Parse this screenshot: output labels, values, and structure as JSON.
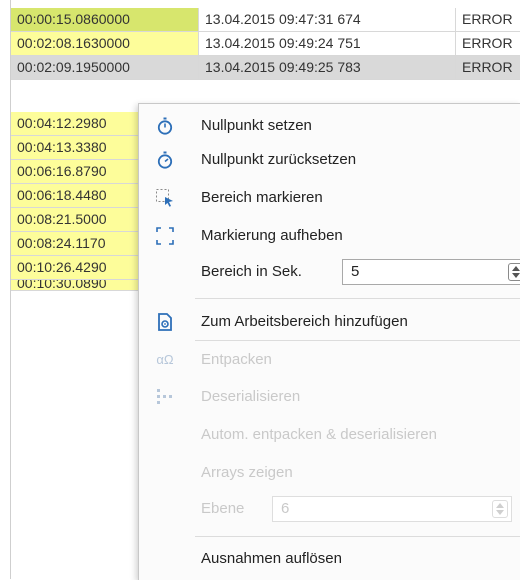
{
  "table": {
    "rows": [
      {
        "time": "00:00:15.0860000",
        "timestamp": "13.04.2015 09:47:31 674",
        "level": "ERROR"
      },
      {
        "time": "00:02:08.1630000",
        "timestamp": "13.04.2015 09:49:24 751",
        "level": "ERROR"
      },
      {
        "time": "00:02:09.1950000",
        "timestamp": "13.04.2015 09:49:25 783",
        "level": "ERROR"
      },
      {
        "time": "00:04:12.2980",
        "timestamp": "",
        "level": ""
      },
      {
        "time": "00:04:13.3380",
        "timestamp": "",
        "level": ""
      },
      {
        "time": "00:06:16.8790",
        "timestamp": "",
        "level": ""
      },
      {
        "time": "00:06:18.4480",
        "timestamp": "",
        "level": ""
      },
      {
        "time": "00:08:21.5000",
        "timestamp": "",
        "level": ""
      },
      {
        "time": "00:08:24.1170",
        "timestamp": "",
        "level": ""
      },
      {
        "time": "00:10:26.4290",
        "timestamp": "",
        "level": ""
      },
      {
        "time": "00:10:30.0890",
        "timestamp": "",
        "level": ""
      }
    ]
  },
  "menu": {
    "set_zero": "Nullpunkt setzen",
    "reset_zero": "Nullpunkt zurücksetzen",
    "mark_range": "Bereich markieren",
    "unmark": "Markierung aufheben",
    "range_label": "Bereich in Sek.",
    "range_value": "5",
    "add_workspace": "Zum Arbeitsbereich hinzufügen",
    "unpack_icon_text": "αΩ",
    "unpack": "Entpacken",
    "deserialize": "Deserialisieren",
    "auto_unpack": "Autom. entpacken & deserialisieren",
    "show_arrays": "Arrays zeigen",
    "level_label": "Ebene",
    "level_value": "6",
    "resolve_exceptions": "Ausnahmen auflösen"
  },
  "colors": {
    "highlight_green": "#d7e66d",
    "highlight_yellow": "#fdfd9a",
    "icon_blue": "#2d6fb8"
  }
}
